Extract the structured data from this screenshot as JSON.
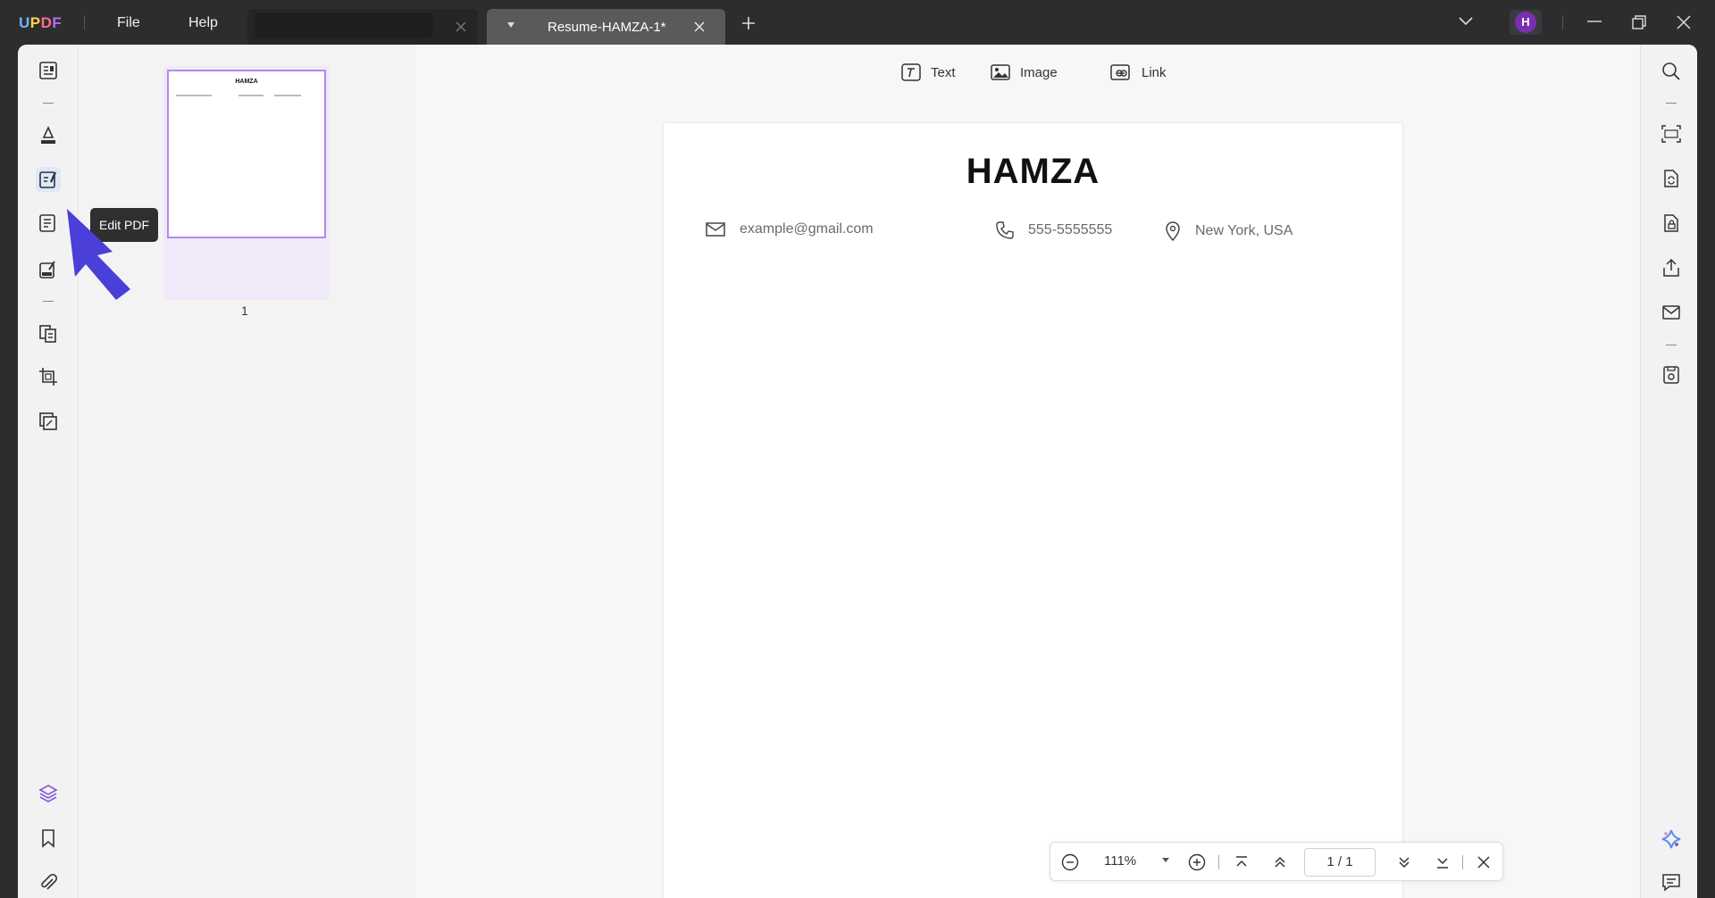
{
  "titlebar": {
    "logo": {
      "u": "U",
      "p": "P",
      "d": "D",
      "f": "F"
    },
    "menu": {
      "file": "File",
      "help": "Help"
    },
    "active_tab": {
      "title": "Resume-HAMZA-1*"
    },
    "avatar_initial": "H"
  },
  "left_rail": {
    "tooltip": "Edit PDF",
    "icons": [
      "reader-icon",
      "comment-icon",
      "edit-pdf-icon",
      "form-icon",
      "sign-icon",
      "organize-pages-icon",
      "crop-icon",
      "watermark-icon",
      "layers-icon",
      "bookmark-icon",
      "attachment-icon"
    ]
  },
  "thumbnails": {
    "page_title": "HAMZA",
    "page_number": "1"
  },
  "edit_toolbar": {
    "text": "Text",
    "image": "Image",
    "link": "Link"
  },
  "document": {
    "name": "HAMZA",
    "email": "example@gmail.com",
    "phone": "555-5555555",
    "location": "New York, USA"
  },
  "zoom_bar": {
    "zoom": "111%",
    "current_page": "1",
    "separator": "/",
    "total_pages": "1"
  },
  "colors": {
    "accent": "#4a3fd8",
    "thumb_border": "#b488ea",
    "avatar": "#7a2fb0"
  }
}
